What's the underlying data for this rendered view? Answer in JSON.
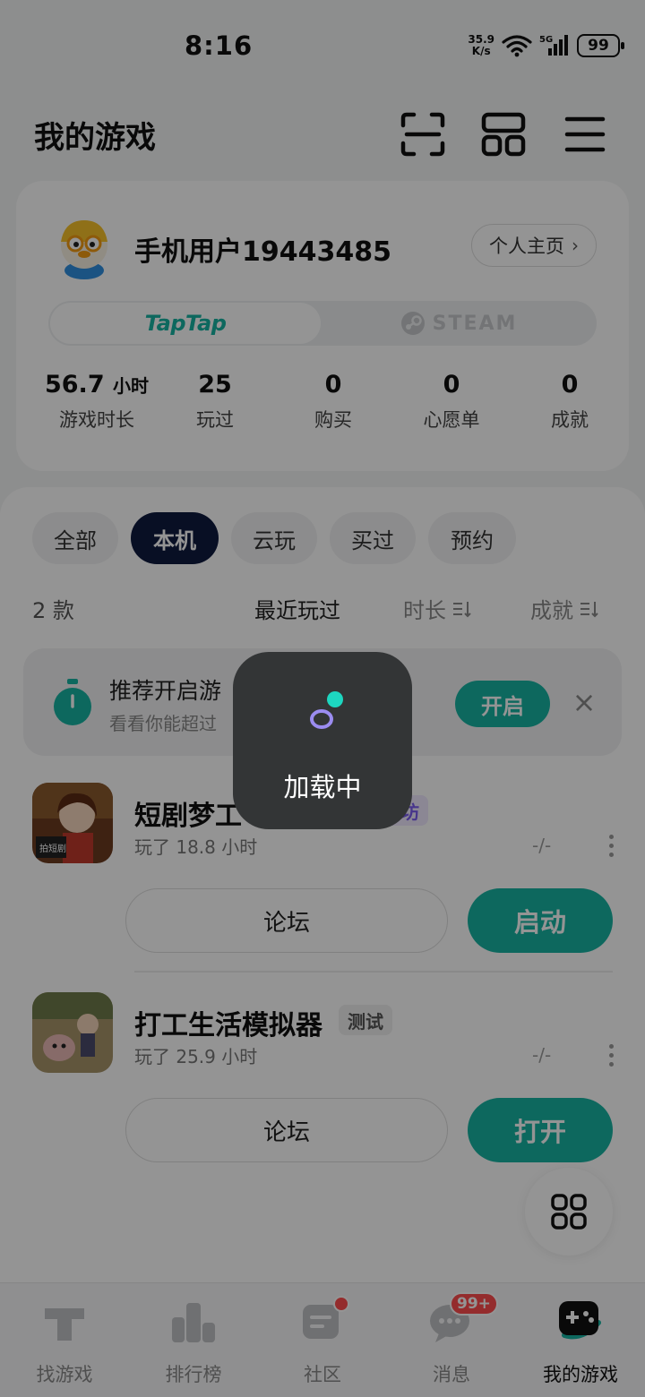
{
  "status_bar": {
    "time": "8:16",
    "net_speed_value": "35.9",
    "net_speed_unit": "K/s",
    "battery": "99"
  },
  "header": {
    "title": "我的游戏",
    "icons": [
      "scan-icon",
      "apps-grid-icon",
      "menu-icon"
    ]
  },
  "profile": {
    "username": "手机用户19443485",
    "homepage_label": "个人主页",
    "platforms": {
      "taptap": "TapTap",
      "steam": "STEAM",
      "selected": "taptap"
    },
    "stats": [
      {
        "value": "56.7",
        "unit": "小时",
        "label": "游戏时长"
      },
      {
        "value": "25",
        "unit": "",
        "label": "玩过"
      },
      {
        "value": "0",
        "unit": "",
        "label": "购买"
      },
      {
        "value": "0",
        "unit": "",
        "label": "心愿单"
      },
      {
        "value": "0",
        "unit": "",
        "label": "成就"
      }
    ]
  },
  "filters": [
    "全部",
    "本机",
    "云玩",
    "买过",
    "预约"
  ],
  "filter_selected": "本机",
  "list": {
    "count": "2 款",
    "sorts": [
      "最近玩过",
      "时长",
      "成就"
    ],
    "sort_selected": "最近玩过"
  },
  "recommend": {
    "title": "推荐开启游",
    "subtitle": "看看你能超过",
    "button": "开启"
  },
  "games": [
    {
      "name": "短剧梦工",
      "tag": "工坊",
      "tag_color": "#7b5cf0",
      "played": "玩了 18.8 小时",
      "achievement": "-/-",
      "forum": "论坛",
      "action": "启动",
      "icon_text": "拍短剧"
    },
    {
      "name": "打工生活模拟器",
      "tag": "测试",
      "tag_color": "#555555",
      "played": "玩了 25.9 小时",
      "achievement": "-/-",
      "forum": "论坛",
      "action": "打开"
    }
  ],
  "bottom_nav": [
    {
      "label": "找游戏",
      "icon": "taptap-logo-icon"
    },
    {
      "label": "排行榜",
      "icon": "ranking-icon"
    },
    {
      "label": "社区",
      "icon": "community-icon",
      "badge_dot": true
    },
    {
      "label": "消息",
      "icon": "message-icon",
      "badge": "99+"
    },
    {
      "label": "我的游戏",
      "icon": "gamepad-icon",
      "active": true
    }
  ],
  "loading_toast": {
    "text": "加载中"
  },
  "colors": {
    "accent": "#17b3a3",
    "dark_chip": "#0f1a3f",
    "badge": "#ff4d4f",
    "overlay": "rgba(0,0,0,0.42)"
  }
}
